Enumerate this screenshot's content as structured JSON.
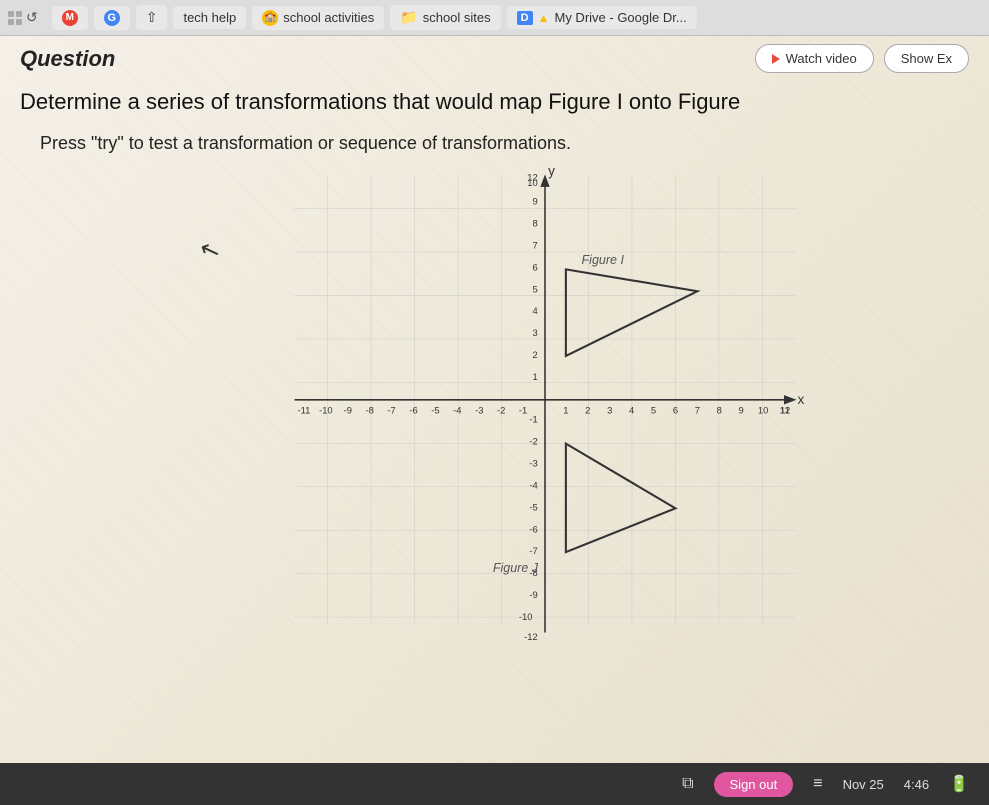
{
  "tabBar": {
    "items": [
      {
        "label": "tech help",
        "iconType": "generic",
        "iconSymbol": "⊕"
      },
      {
        "label": "school activities",
        "iconType": "school",
        "iconSymbol": "🏫"
      },
      {
        "label": "school sites",
        "iconType": "folder",
        "iconSymbol": "📁"
      },
      {
        "label": "My Drive - Google Dr...",
        "iconType": "drive",
        "iconSymbol": "D"
      }
    ]
  },
  "header": {
    "questionLabel": "Question",
    "watchVideoBtn": "Watch video",
    "showExBtn": "Show Ex"
  },
  "question": {
    "text": "Determine a series of transformations that would map Figure I onto Figure",
    "instruction": "Press \"try\" to test a transformation or sequence of transformations."
  },
  "graph": {
    "xAxisLabel": "x",
    "yAxisLabel": "y",
    "figureILabel": "Figure I",
    "figureJLabel": "Figure J",
    "xMin": -12,
    "xMax": 12,
    "yMin": -12,
    "yMax": 12,
    "figureI": [
      [
        1,
        6
      ],
      [
        7,
        5
      ],
      [
        1,
        2
      ]
    ],
    "figureJ": [
      [
        1,
        -2
      ],
      [
        6,
        -5
      ],
      [
        1,
        -7
      ]
    ]
  },
  "bottomBar": {
    "signOutLabel": "Sign out",
    "date": "Nov 25",
    "time": "4:46"
  }
}
